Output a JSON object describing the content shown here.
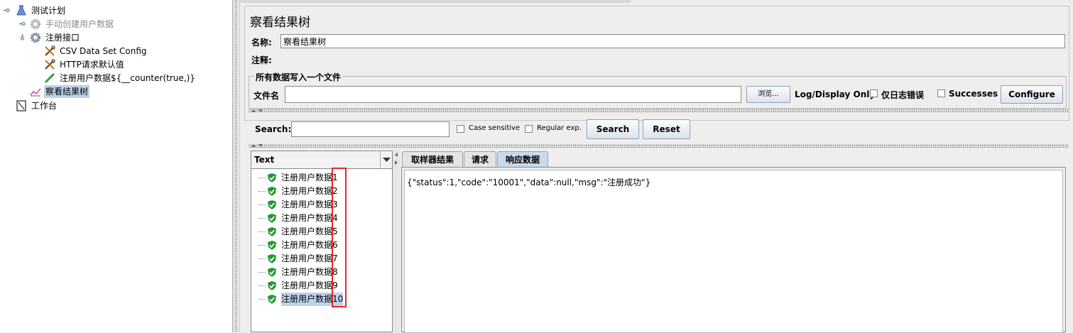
{
  "tree": {
    "items": [
      {
        "label": "测试计划",
        "icon": "flask-icon"
      },
      {
        "label": "手动创建用户数据",
        "icon": "gear-icon"
      },
      {
        "label": "注册接口",
        "icon": "gear-icon"
      },
      {
        "label": "CSV Data Set Config",
        "icon": "wrench-icon"
      },
      {
        "label": "HTTP请求默认值",
        "icon": "wrench-icon"
      },
      {
        "label": "注册用户数据${__counter(true,)}",
        "icon": "pipette-icon"
      },
      {
        "label": "察看结果树",
        "icon": "graph-icon"
      },
      {
        "label": "工作台",
        "icon": "clipboard-icon"
      }
    ]
  },
  "panel": {
    "title": "察看结果树",
    "name_label": "名称:",
    "name_value": "察看结果树",
    "comment_label": "注释:",
    "comment_value": "",
    "file_section_title": "所有数据写入一个文件",
    "filename_label": "文件名",
    "filename_value": "",
    "browse_label": "浏览...",
    "log_display_label": "Log/Display Only:",
    "errors_only_label": "仅日志错误",
    "successes_label": "Successes",
    "configure_label": "Configure"
  },
  "search": {
    "label": "Search:",
    "value": "",
    "case_sensitive_label": "Case sensitive",
    "regex_label": "Regular exp.",
    "search_button": "Search",
    "reset_button": "Reset"
  },
  "renderer": {
    "selected": "Text"
  },
  "results": {
    "prefix": "注册用户数据",
    "items": [
      "1",
      "2",
      "3",
      "4",
      "5",
      "6",
      "7",
      "8",
      "9",
      "10"
    ]
  },
  "tabs": [
    {
      "label": "取样器结果"
    },
    {
      "label": "请求"
    },
    {
      "label": "响应数据"
    }
  ],
  "response": {
    "body": "{\"status\":1,\"code\":\"10001\",\"data\":null,\"msg\":\"注册成功\"}"
  },
  "colors": {
    "selection": "#bdd3ec",
    "highlight_box": "#e8282a",
    "success": "#1e9a32"
  }
}
